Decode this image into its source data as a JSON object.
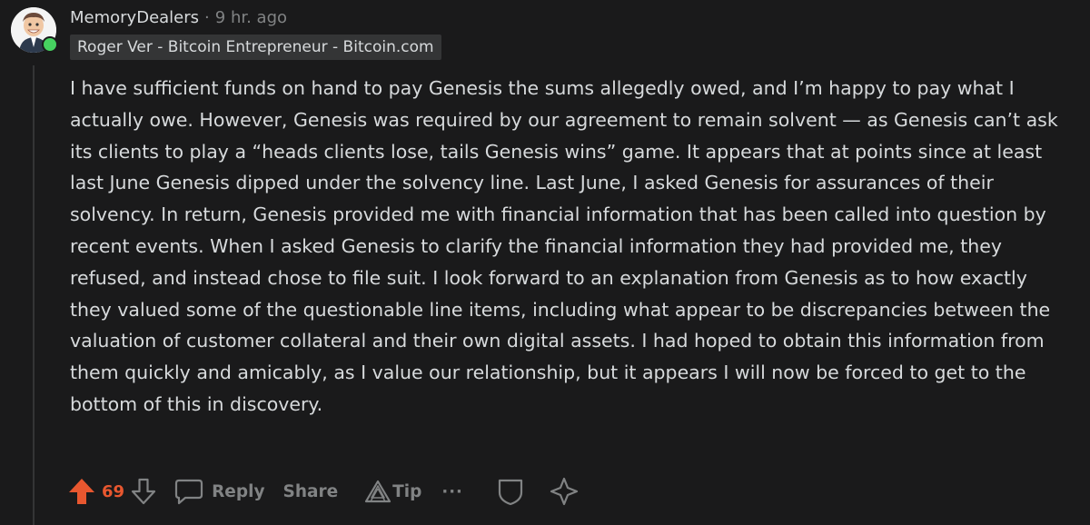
{
  "comment": {
    "username": "MemoryDealers",
    "separator": "·",
    "time": "9 hr. ago",
    "flair": "Roger Ver - Bitcoin Entrepreneur - Bitcoin.com",
    "body": "I have sufficient funds on hand to pay Genesis the sums allegedly owed, and I’m happy to pay what I actually owe. However, Genesis was required by our agreement to remain solvent — as Genesis can’t ask its clients to play a “heads clients lose, tails Genesis wins” game. It appears that at points since at least last June Genesis dipped under the solvency line. Last June, I asked Genesis for assurances of their solvency. In return, Genesis provided me with financial information that has been called into question by recent events. When I asked Genesis to clarify the financial information they had provided me, they refused, and instead chose to file suit. I look forward to an explanation from Genesis as to how exactly they valued some of the questionable line items, including what appear to be discrepancies between the valuation of customer collateral and their own digital assets. I had hoped to obtain this information from them quickly and amicably, as I value our relationship, but it appears I will now be forced to get to the bottom of this in discovery."
  },
  "actions": {
    "score": "69",
    "reply_label": "Reply",
    "share_label": "Share",
    "tip_label": "Tip",
    "more_label": "···"
  },
  "icons": {
    "upvote": "upvote-arrow-icon",
    "downvote": "downvote-arrow-icon",
    "reply": "speech-bubble-icon",
    "tip": "tip-triangle-icon",
    "more": "more-dots-icon",
    "shield": "shield-icon",
    "award": "award-star-icon"
  },
  "colors": {
    "background": "#1a1a1b",
    "text": "#d7dadc",
    "muted": "#818384",
    "upvote": "#e8572f",
    "online": "#46d160",
    "flair_bg": "#343536"
  }
}
